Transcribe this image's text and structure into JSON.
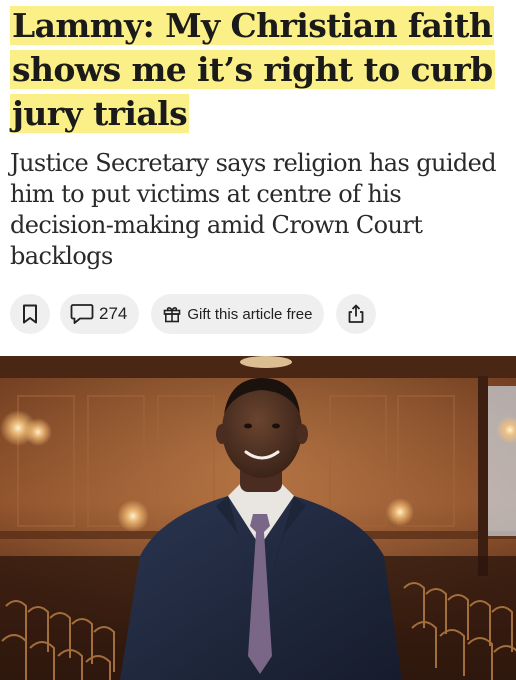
{
  "article": {
    "headline": "Lammy: My Christian faith shows me it’s right to curb jury trials",
    "standfirst": "Justice Secretary says religion has guided him to put victims at centre of his decision-making amid Crown Court backlogs",
    "highlight_color": "#fbef87"
  },
  "actions": {
    "bookmark_icon": "bookmark-icon",
    "comment_icon": "comment-icon",
    "comment_count": "274",
    "gift_icon": "gift-icon",
    "gift_label": "Gift this article free",
    "share_icon": "share-icon",
    "pill_color": "#efefef"
  },
  "photo": {
    "subject": "man in navy suit and purple tie standing in a wood-panelled hall with empty chairs"
  }
}
